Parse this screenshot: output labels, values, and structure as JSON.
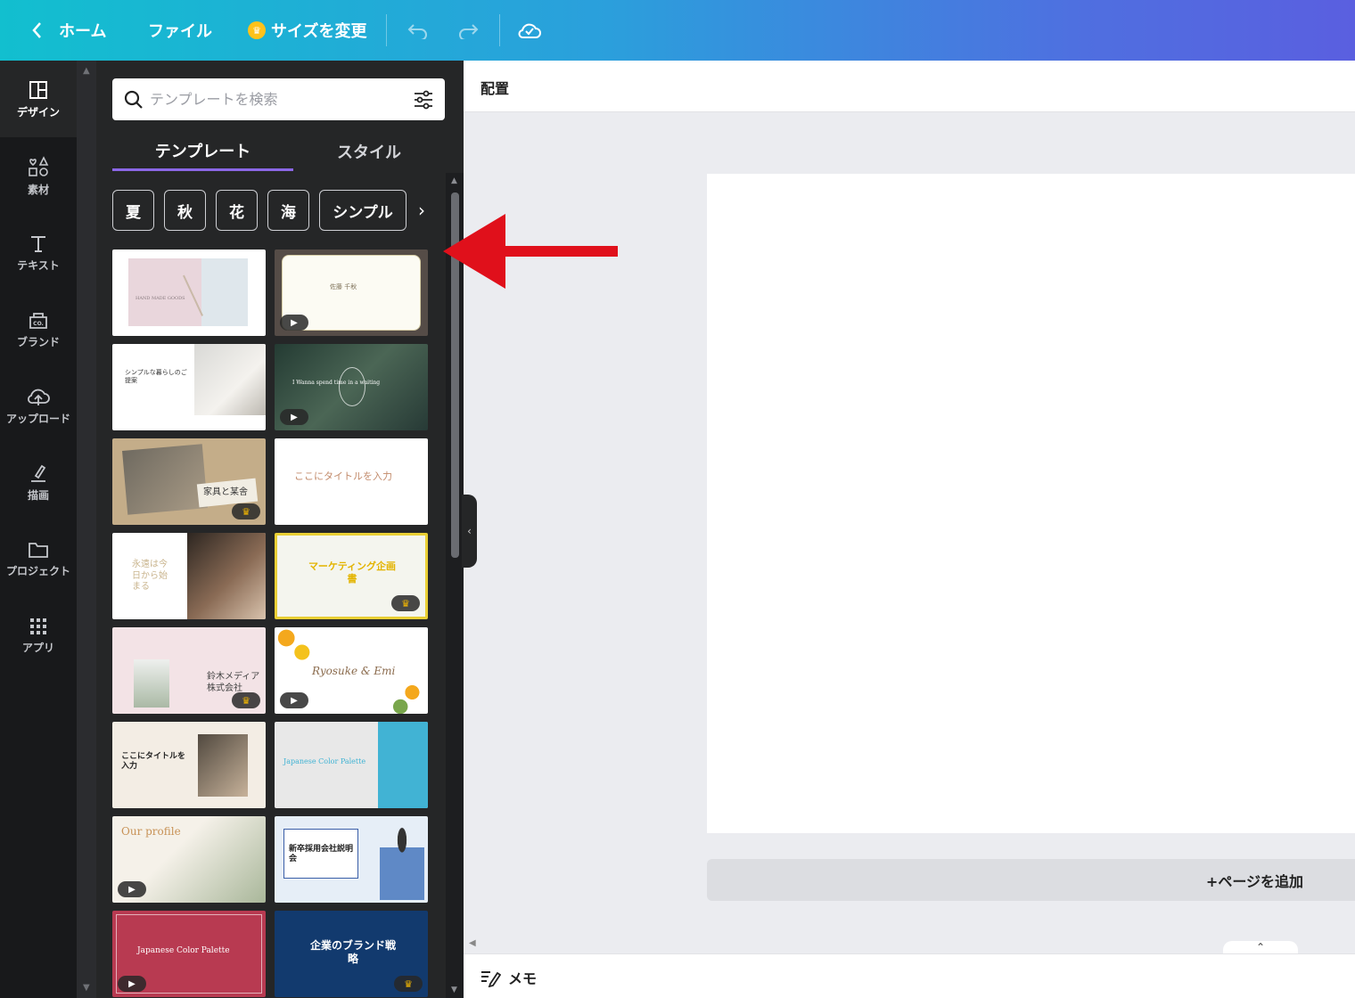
{
  "topbar": {
    "back_icon": "chevron-left-icon",
    "home": "ホーム",
    "file": "ファイル",
    "resize": "サイズを変更",
    "undo_icon": "undo-icon",
    "redo_icon": "redo-icon",
    "cloud_icon": "cloud-check-icon"
  },
  "rail": {
    "items": [
      {
        "label": "デザイン",
        "icon": "layout-icon"
      },
      {
        "label": "素材",
        "icon": "shapes-icon"
      },
      {
        "label": "テキスト",
        "icon": "text-icon"
      },
      {
        "label": "ブランド",
        "icon": "brand-icon"
      },
      {
        "label": "アップロード",
        "icon": "upload-cloud-icon"
      },
      {
        "label": "描画",
        "icon": "draw-icon"
      },
      {
        "label": "プロジェクト",
        "icon": "folder-icon"
      },
      {
        "label": "アプリ",
        "icon": "apps-grid-icon"
      }
    ]
  },
  "panel": {
    "search_placeholder": "テンプレートを検索",
    "tabs": [
      "テンプレート",
      "スタイル"
    ],
    "chips": [
      "夏",
      "秋",
      "花",
      "海",
      "シンプル"
    ],
    "templates": [
      {
        "text": "HAND MADE GOODS",
        "badge": ""
      },
      {
        "text": "佐藤 千秋",
        "badge": "play"
      },
      {
        "text": "シンプルな暮らしのご提案",
        "badge": ""
      },
      {
        "text": "I Wanna spend time in a waiting",
        "badge": "play"
      },
      {
        "text": "家具と某舎",
        "badge": "crown"
      },
      {
        "text": "ここにタイトルを入力",
        "badge": ""
      },
      {
        "text": "永遠は今日から始まる",
        "badge": ""
      },
      {
        "text": "マーケティング企画書",
        "badge": "crown"
      },
      {
        "text": "鈴木メディア株式会社",
        "badge": "crown"
      },
      {
        "text": "Ryosuke & Emi",
        "badge": "play"
      },
      {
        "text": "ここにタイトルを入力",
        "badge": ""
      },
      {
        "text": "Japanese Color Palette",
        "badge": ""
      },
      {
        "text": "Our profile",
        "badge": "play"
      },
      {
        "text": "新卒採用会社説明会",
        "badge": ""
      },
      {
        "text": "Japanese Color Palette",
        "badge": "play"
      },
      {
        "text": "企業のブランド戦略",
        "badge": "crown"
      }
    ]
  },
  "editor": {
    "toolbar_label": "配置",
    "add_page": "+ページを追加",
    "memo": "メモ"
  },
  "colors": {
    "accent": "#8b67e6",
    "annotation_arrow": "#e0101b"
  }
}
